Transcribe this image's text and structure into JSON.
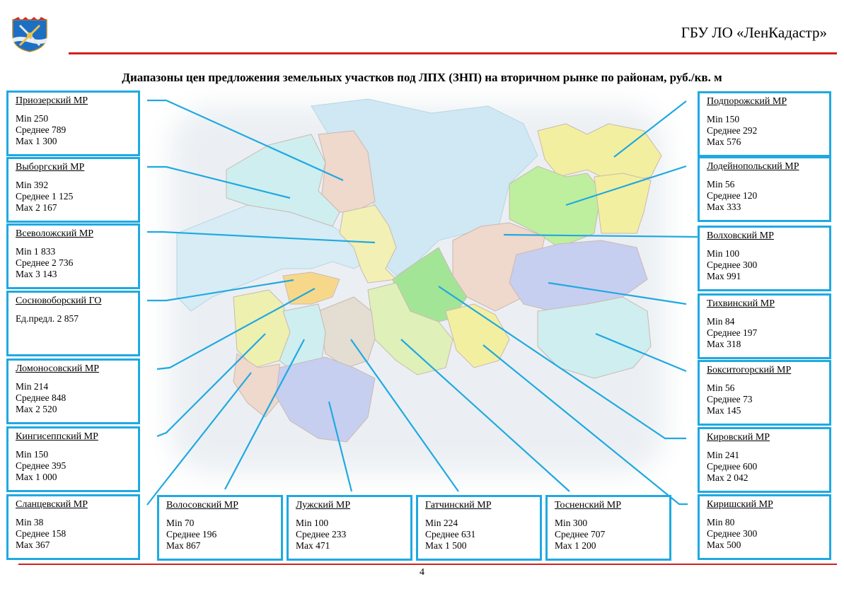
{
  "header": {
    "organization": "ГБУ ЛО «ЛенКадастр»"
  },
  "title": "Диапазоны цен предложения земельных участков под ЛПХ (ЗНП) на вторичном рынке по районам, руб./кв. м",
  "page_number": "4",
  "colors": {
    "accent_red": "#d21f1f",
    "frame_blue": "#1fa9e1",
    "water": "#cfe8f3"
  },
  "districts": [
    {
      "name": "Приозерский МР",
      "lines": [
        "Min 250",
        "Среднее 789",
        "Max 1 300"
      ]
    },
    {
      "name": "Выборгский МР",
      "lines": [
        "Min 392",
        "Среднее 1 125",
        "Max 2 167"
      ]
    },
    {
      "name": "Всеволожский МР",
      "lines": [
        "Min 1 833",
        "Среднее 2 736",
        "Max 3 143"
      ]
    },
    {
      "name": "Сосновоборский ГО",
      "lines": [
        "Ед.предл. 2 857"
      ]
    },
    {
      "name": "Ломоносовский МР",
      "lines": [
        "Min 214",
        "Среднее 848",
        "Max 2 520"
      ]
    },
    {
      "name": "Кингисеппский МР",
      "lines": [
        "Min 150",
        "Среднее 395",
        "Max 1 000"
      ]
    },
    {
      "name": "Сланцевский МР",
      "lines": [
        "Min 38",
        "Среднее 158",
        "Max 367"
      ]
    },
    {
      "name": "Волосовский МР",
      "lines": [
        "Min 70",
        "Среднее 196",
        "Max 867"
      ]
    },
    {
      "name": "Лужский МР",
      "lines": [
        "Min 100",
        "Среднее 233",
        "Max 471"
      ]
    },
    {
      "name": "Гатчинский МР",
      "lines": [
        "Min 224",
        "Среднее 631",
        "Max 1 500"
      ]
    },
    {
      "name": "Тосненский МР",
      "lines": [
        "Min 300",
        "Среднее 707",
        "Max 1 200"
      ]
    },
    {
      "name": "Подпорожский МР",
      "lines": [
        "Min 150",
        "Среднее 292",
        "Max 576"
      ]
    },
    {
      "name": "Лодейнопольский МР",
      "lines": [
        "Min 56",
        "Среднее 120",
        "Max 333"
      ]
    },
    {
      "name": "Волховский МР",
      "lines": [
        "Min 100",
        "Среднее 300",
        "Max 991"
      ]
    },
    {
      "name": "Тихвинский МР",
      "lines": [
        "Min 84",
        "Среднее 197",
        "Max 318"
      ]
    },
    {
      "name": "Бокситогорский МР",
      "lines": [
        "Min 56",
        "Среднее 73",
        "Max 145"
      ]
    },
    {
      "name": "Кировский МР",
      "lines": [
        "Min 241",
        "Среднее 600",
        "Max 2 042"
      ]
    },
    {
      "name": "Киришский МР",
      "lines": [
        "Min 80",
        "Среднее 300",
        "Max 500"
      ]
    }
  ]
}
